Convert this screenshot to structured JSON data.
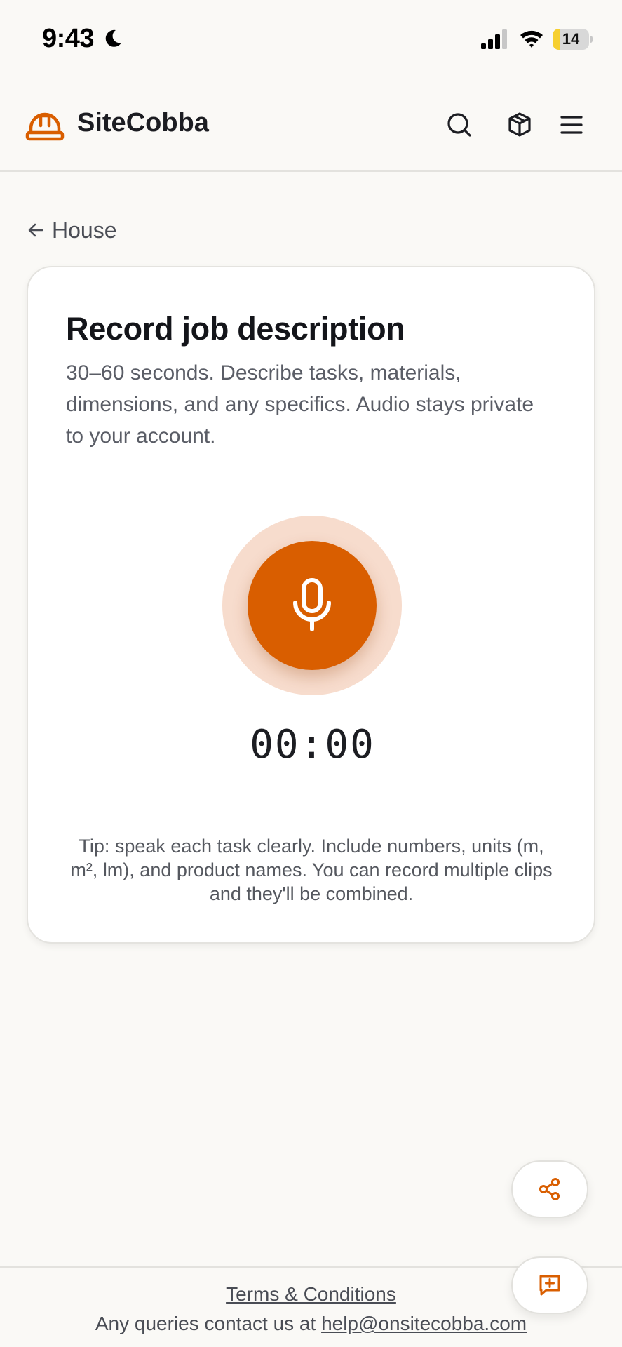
{
  "status_bar": {
    "time": "9:43",
    "battery_level": "14",
    "battery_fraction": 0.14,
    "battery_color": "#f6cf2f"
  },
  "header": {
    "brand": "SiteCobba",
    "logo_icon": "hard-hat-icon",
    "icons": [
      "search-icon",
      "box-icon",
      "menu-icon"
    ],
    "accent_color": "#d95e00"
  },
  "nav": {
    "back_label": "House"
  },
  "card": {
    "title": "Record job description",
    "description": "30–60 seconds. Describe tasks, materials, dimensions, and any specifics. Audio stays private to your account.",
    "mic_icon": "microphone-icon",
    "timer": "00:00",
    "tip": "Tip: speak each task clearly. Include numbers, units (m, m², lm), and product names. You can record multiple clips and they'll be combined."
  },
  "fabs": {
    "share_icon": "share-icon",
    "feedback_icon": "message-plus-icon"
  },
  "footer": {
    "terms_label": "Terms & Conditions",
    "contact_prefix": "Any queries contact us at ",
    "contact_email": "help@onsitecobba.com"
  }
}
